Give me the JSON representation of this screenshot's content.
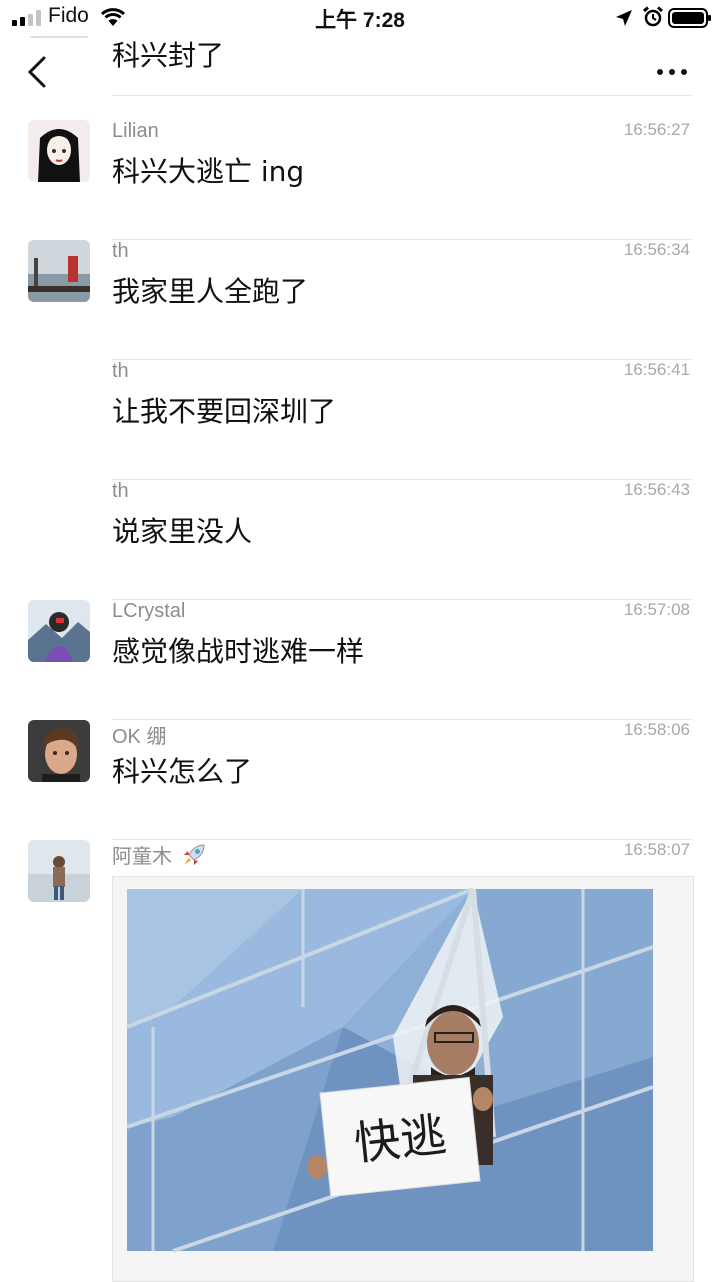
{
  "status_bar": {
    "carrier": "Fido",
    "time": "上午 7:28"
  },
  "messages": [
    {
      "name": "",
      "text": "科兴封了",
      "time": ""
    },
    {
      "name": "Lilian",
      "text": "科兴大逃亡 ing",
      "time": "16:56:27"
    },
    {
      "name": "th",
      "text": "我家里人全跑了",
      "time": "16:56:34"
    },
    {
      "name": "th",
      "text": "让我不要回深圳了",
      "time": "16:56:41"
    },
    {
      "name": "th",
      "text": "说家里没人",
      "time": "16:56:43"
    },
    {
      "name": "LCrystal",
      "text": "感觉像战时逃难一样",
      "time": "16:57:08"
    },
    {
      "name": "OK 绷",
      "text": "科兴怎么了",
      "time": "16:58:06"
    },
    {
      "name": "阿童木",
      "text": "",
      "time": "16:58:07"
    }
  ],
  "image_message": {
    "sign_text": "快逃"
  },
  "icons": {
    "rocket": "rocket-emoji",
    "back": "chevron-left-icon",
    "more": "more-dots-icon"
  }
}
